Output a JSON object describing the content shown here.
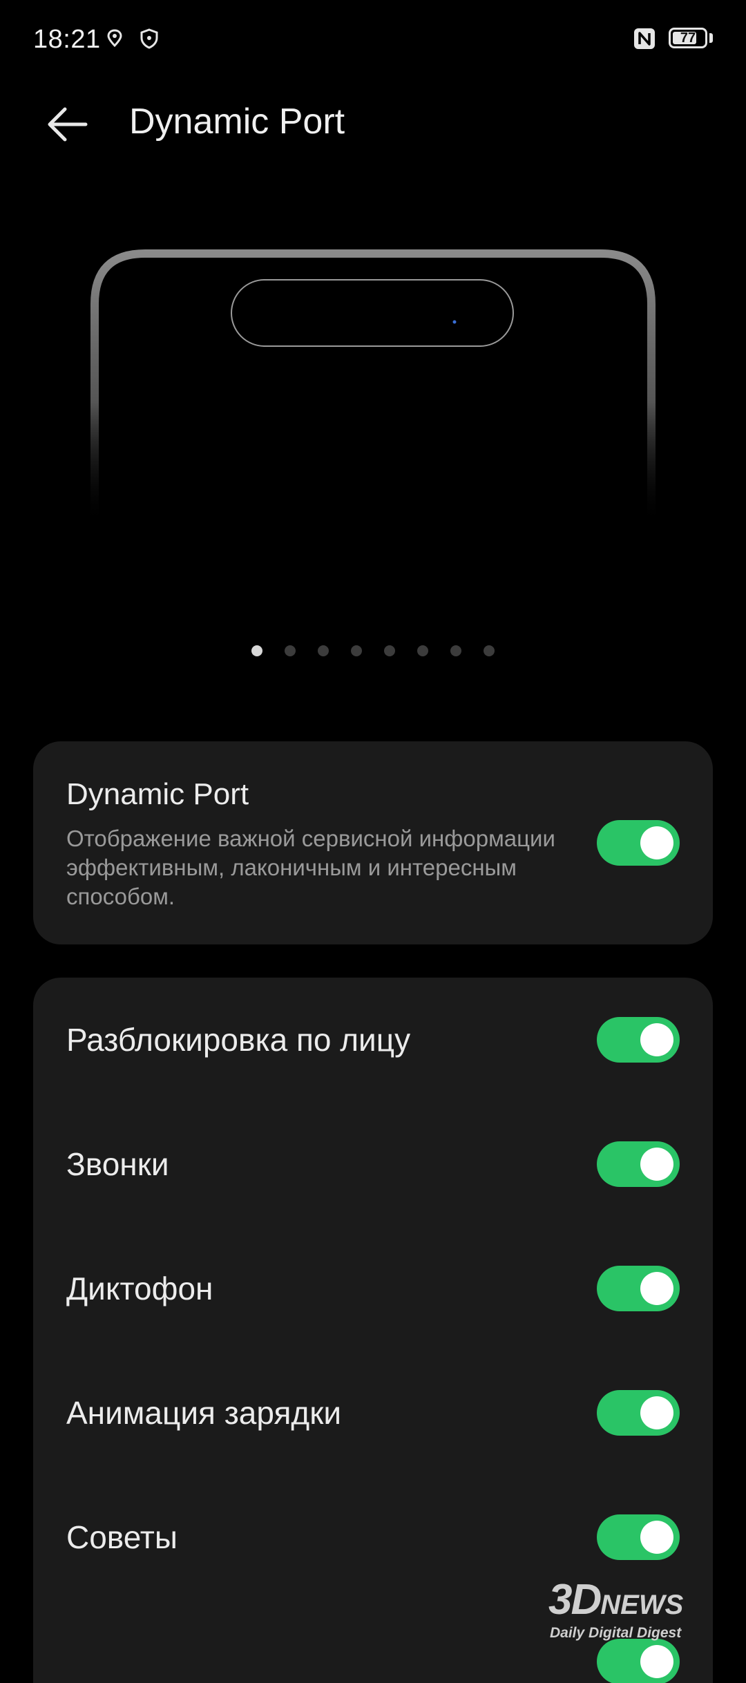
{
  "status_bar": {
    "time": "18:21",
    "battery_level": 77,
    "battery_text": "77",
    "icons": [
      "location-pin-icon",
      "shield-icon",
      "nfc-icon",
      "battery-icon"
    ]
  },
  "header": {
    "back_icon": "arrow-left-icon",
    "title": "Dynamic Port"
  },
  "preview": {
    "pager": {
      "total": 8,
      "active_index": 0
    }
  },
  "main_card": {
    "title": "Dynamic Port",
    "description": "Отображение важной сервисной информации эффективным, лаконичным и интересным способом.",
    "toggle_on": true
  },
  "settings": {
    "items": [
      {
        "label": "Разблокировка по лицу",
        "on": true
      },
      {
        "label": "Звонки",
        "on": true
      },
      {
        "label": "Диктофон",
        "on": true
      },
      {
        "label": "Анимация зарядки",
        "on": true
      },
      {
        "label": "Советы",
        "on": true
      },
      {
        "label": "",
        "on": true
      }
    ]
  },
  "watermark": {
    "logo_main": "3D",
    "logo_sub": "NEWS",
    "tagline": "Daily Digital Digest"
  },
  "colors": {
    "background": "#000000",
    "card": "#1b1b1b",
    "toggle_on": "#2ac466",
    "text_primary": "#ececec",
    "text_secondary": "#9a9a9a"
  }
}
